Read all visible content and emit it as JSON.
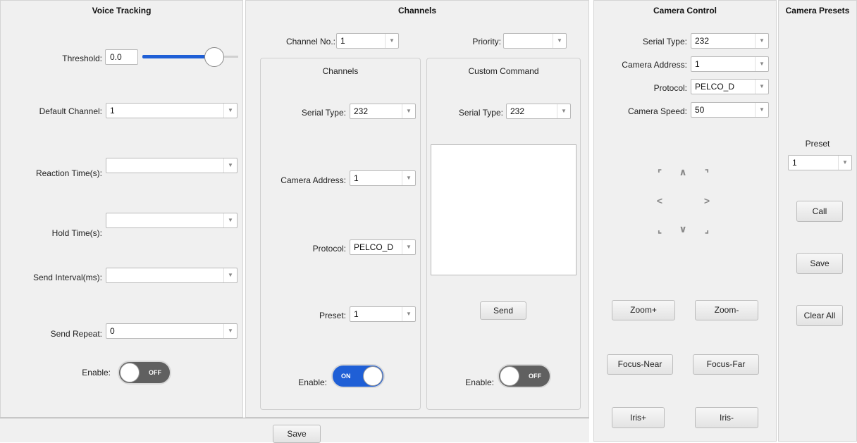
{
  "voice_tracking": {
    "title": "Voice Tracking",
    "threshold_label": "Threshold:",
    "threshold_value": "0.0",
    "threshold_slider_level": 0.75,
    "default_channel_label": "Default Channel:",
    "default_channel_value": "1",
    "reaction_time_label": "Reaction Time(s):",
    "reaction_time_value": "",
    "hold_time_label": "Hold Time(s):",
    "hold_time_value": "",
    "send_interval_label": "Send Interval(ms):",
    "send_interval_value": "",
    "send_repeat_label": "Send Repeat:",
    "send_repeat_value": "0",
    "enable_label": "Enable:",
    "enable_state": "OFF"
  },
  "channels": {
    "title": "Channels",
    "channel_no_label": "Channel No.:",
    "channel_no_value": "1",
    "priority_label": "Priority:",
    "priority_value": "",
    "group": {
      "title": "Channels",
      "serial_type_label": "Serial Type:",
      "serial_type_value": "232",
      "camera_address_label": "Camera Address:",
      "camera_address_value": "1",
      "protocol_label": "Protocol:",
      "protocol_value": "PELCO_D",
      "preset_label": "Preset:",
      "preset_value": "1",
      "enable_label": "Enable:",
      "enable_state": "ON"
    },
    "custom_command": {
      "title": "Custom Command",
      "serial_type_label": "Serial Type:",
      "serial_type_value": "232",
      "command_text": "",
      "send_label": "Send",
      "enable_label": "Enable:",
      "enable_state": "OFF"
    }
  },
  "footer": {
    "save_label": "Save"
  },
  "camera_control": {
    "title": "Camera Control",
    "serial_type_label": "Serial Type:",
    "serial_type_value": "232",
    "camera_address_label": "Camera Address:",
    "camera_address_value": "1",
    "protocol_label": "Protocol:",
    "protocol_value": "PELCO_D",
    "camera_speed_label": "Camera Speed:",
    "camera_speed_value": "50",
    "ptz_icons": [
      "up-left",
      "up",
      "up-right",
      "left",
      "right",
      "down-left",
      "down",
      "down-right"
    ],
    "zoom_in_label": "Zoom+",
    "zoom_out_label": "Zoom-",
    "focus_near_label": "Focus-Near",
    "focus_far_label": "Focus-Far",
    "iris_open_label": "Iris+",
    "iris_close_label": "Iris-"
  },
  "camera_presets": {
    "title": "Camera Presets",
    "preset_label": "Preset",
    "preset_value": "1",
    "call_label": "Call",
    "save_label": "Save",
    "clear_all_label": "Clear All"
  },
  "colors": {
    "panel_bg": "#f0f0f0",
    "accent_blue": "#1f5fd6",
    "toggle_off": "#606060"
  }
}
